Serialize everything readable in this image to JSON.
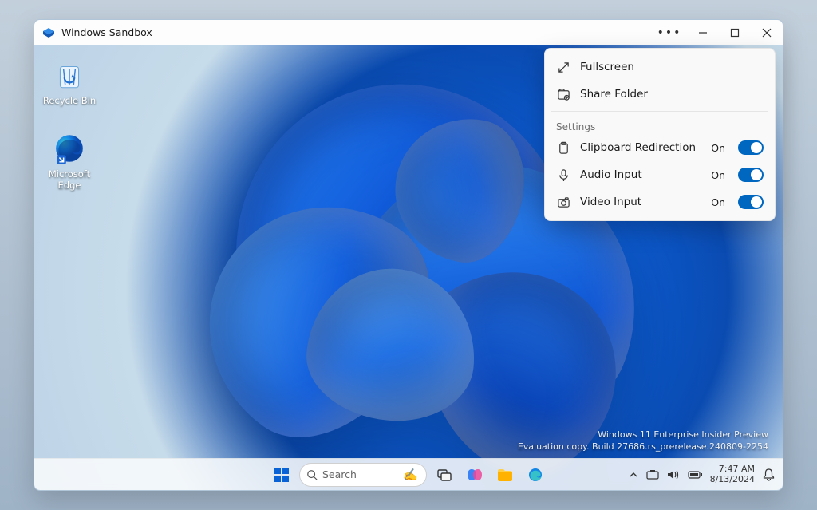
{
  "window": {
    "title": "Windows Sandbox"
  },
  "desktop_icons": {
    "recycle_bin": "Recycle Bin",
    "edge": "Microsoft Edge"
  },
  "watermark": {
    "line1": "Windows 11 Enterprise Insider Preview",
    "line2": "Evaluation copy. Build 27686.rs_prerelease.240809-2254"
  },
  "flyout": {
    "fullscreen": "Fullscreen",
    "share_folder": "Share Folder",
    "settings_label": "Settings",
    "clipboard": {
      "label": "Clipboard Redirection",
      "state": "On"
    },
    "audio": {
      "label": "Audio Input",
      "state": "On"
    },
    "video": {
      "label": "Video Input",
      "state": "On"
    }
  },
  "taskbar": {
    "search_placeholder": "Search",
    "time": "7:47 AM",
    "date": "8/13/2024"
  },
  "colors": {
    "accent": "#0067c0"
  }
}
